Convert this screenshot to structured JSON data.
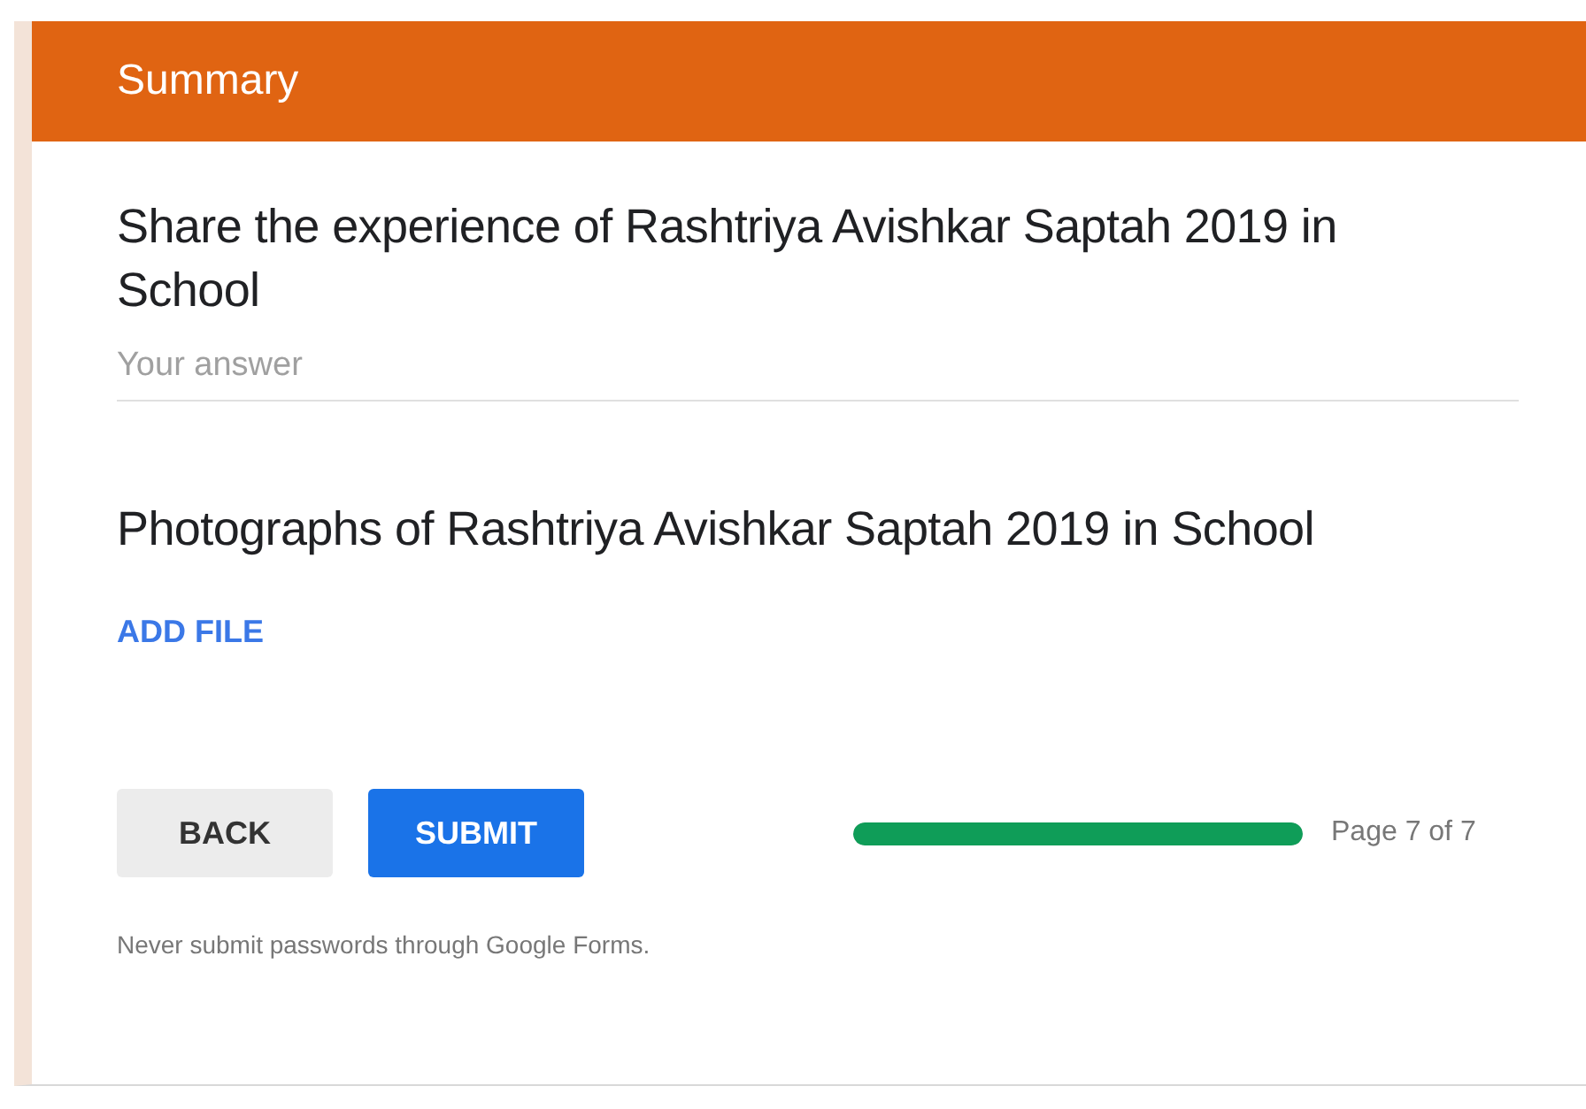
{
  "header": {
    "title": "Summary"
  },
  "questions": [
    {
      "kind": "text",
      "title": "Share the experience of Rashtriya Avishkar Saptah 2019 in School",
      "placeholder": "Your answer"
    },
    {
      "kind": "file",
      "title": "Photographs of Rashtriya Avishkar Saptah 2019 in School",
      "action": "ADD FILE"
    }
  ],
  "buttons": [
    {
      "label": "BACK",
      "primary": false
    },
    {
      "label": "SUBMIT",
      "primary": true
    }
  ],
  "progress": {
    "level": 1,
    "label": "Page 7 of 7"
  },
  "footer_note": "Never submit passwords through Google Forms."
}
